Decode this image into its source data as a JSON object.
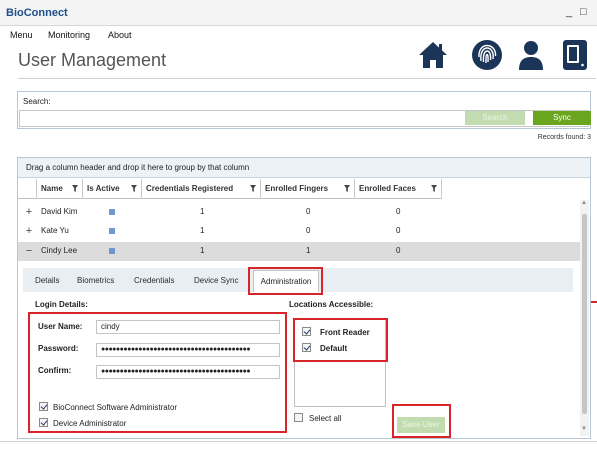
{
  "app": {
    "title": "BioConnect",
    "minimize": "_",
    "maximize": "□"
  },
  "menu": [
    "Menu",
    "Monitoring",
    "About"
  ],
  "page_title": "User Management",
  "nav_icons": [
    "home-icon",
    "fingerprint-icon",
    "user-icon",
    "device-icon"
  ],
  "search": {
    "label": "Search:",
    "value": "",
    "placeholder": "",
    "search_button": "Search",
    "sync_button": "Sync",
    "records_found": "Records found: 3"
  },
  "grid": {
    "group_hint": "Drag a column header and drop it here to group by that column",
    "columns": [
      "Name",
      "Is Active",
      "Credentials Registered",
      "Enrolled Fingers",
      "Enrolled Faces"
    ],
    "rows": [
      {
        "expander": "+",
        "name": "David Kim",
        "is_active": true,
        "credentials": "1",
        "fingers": "0",
        "faces": "0"
      },
      {
        "expander": "+",
        "name": "Kate Yu",
        "is_active": true,
        "credentials": "1",
        "fingers": "0",
        "faces": "0"
      },
      {
        "expander": "−",
        "name": "Cindy Lee",
        "is_active": true,
        "credentials": "1",
        "fingers": "1",
        "faces": "0"
      }
    ]
  },
  "tabs": {
    "items": [
      "Details",
      "Biometrics",
      "Credentials",
      "Device Sync"
    ],
    "active": "Administration"
  },
  "login": {
    "title": "Login Details:",
    "username_label": "User Name:",
    "username_value": "cindy",
    "password_label": "Password:",
    "password_value": "●●●●●●●●●●●●●●●●●●●●●●●●●●●●●●●●●●●●●●●●",
    "confirm_label": "Confirm:",
    "confirm_value": "●●●●●●●●●●●●●●●●●●●●●●●●●●●●●●●●●●●●●●●●",
    "software_admin_label": "BioConnect Software Administrator",
    "software_admin_checked": true,
    "device_admin_label": "Device  Administrator",
    "device_admin_checked": true
  },
  "locations": {
    "title": "Locations Accessible:",
    "items": [
      {
        "label": "Front Reader",
        "checked": true
      },
      {
        "label": "Default",
        "checked": true
      }
    ],
    "select_all_label": "Select all",
    "select_all_checked": false
  },
  "save_button": "Save User",
  "colors": {
    "brand": "#1e4e8c",
    "sync_green": "#6aa51f",
    "disabled_green": "#c3dbb0",
    "highlight_red": "#d8242b",
    "selected_row": "#dcdcdc"
  }
}
